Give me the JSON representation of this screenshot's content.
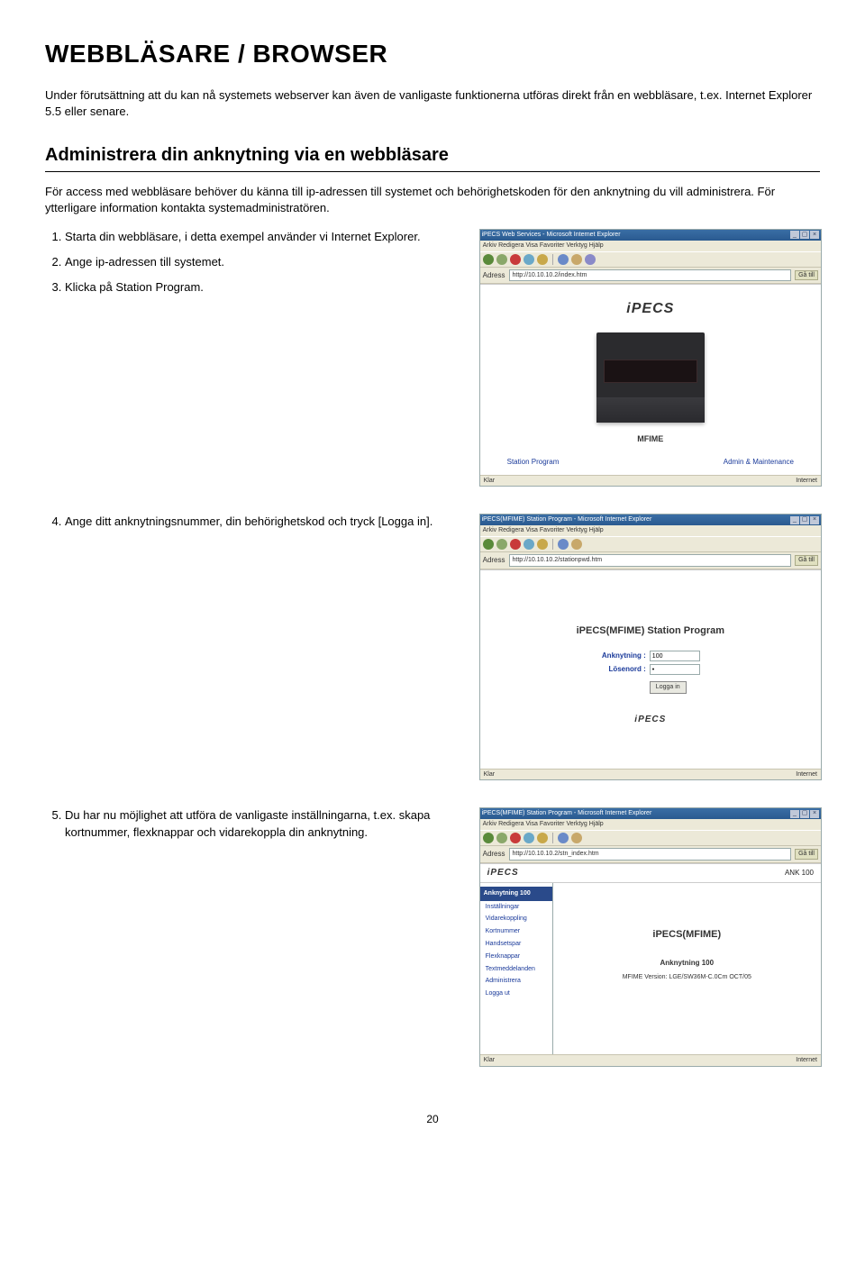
{
  "page": {
    "title": "WEBBLÄSARE / BROWSER",
    "intro": "Under förutsättning att du kan nå systemets webserver kan även de vanligaste funktionerna utföras direkt från en webbläsare, t.ex. Internet Explorer 5.5 eller senare.",
    "section_title": "Administrera din anknytning via en webbläsare",
    "section_intro": "För access med webbläsare behöver du känna till ip-adressen till systemet och behörighetskoden för den anknytning du vill administrera. För ytterligare information kontakta systemadministratören.",
    "page_number": "20"
  },
  "steps": {
    "s1": "Starta din webbläsare, i detta exempel använder vi Internet Explorer.",
    "s2": "Ange ip-adressen till systemet.",
    "s3": "Klicka på Station Program.",
    "s4": "Ange ditt anknytningsnummer, din behörighetskod och tryck [Logga in].",
    "s5": "Du har nu möjlighet att utföra de vanligaste inställningarna, t.ex. skapa kortnummer, flexknappar och vidarekoppla din anknytning."
  },
  "screenshot1": {
    "window_title": "iPECS Web Services - Microsoft Internet Explorer",
    "menubar": "Arkiv   Redigera   Visa   Favoriter   Verktyg   Hjälp",
    "address_label": "Adress",
    "address": "http://10.10.10.2/index.htm",
    "go": "Gå till",
    "logo": "iPECS",
    "model": "MFIME",
    "link_left": "Station Program",
    "link_right": "Admin & Maintenance",
    "status_left": "Klar",
    "status_right": "Internet"
  },
  "screenshot2": {
    "window_title": "iPECS(MFIME) Station Program - Microsoft Internet Explorer",
    "menubar": "Arkiv   Redigera   Visa   Favoriter   Verktyg   Hjälp",
    "address_label": "Adress",
    "address": "http://10.10.10.2/stationpwd.htm",
    "go": "Gå till",
    "title": "iPECS(MFIME) Station Program",
    "label_ext": "Anknytning :",
    "value_ext": "100",
    "label_pwd": "Lösenord :",
    "value_pwd": "•",
    "login": "Logga in",
    "ipecs": "iPECS",
    "status_left": "Klar",
    "status_right": "Internet"
  },
  "screenshot3": {
    "window_title": "iPECS(MFIME) Station Program - Microsoft Internet Explorer",
    "menubar": "Arkiv   Redigera   Visa   Favoriter   Verktyg   Hjälp",
    "address_label": "Adress",
    "address": "http://10.10.10.2/stn_index.htm",
    "go": "Gå till",
    "header_logo": "iPECS",
    "header_station": "ANK 100",
    "side_head": "Anknytning 100",
    "side_items": [
      "Inställningar",
      "Vidarekoppling",
      "Kortnummer",
      "Handsetspar",
      "Flexknappar",
      "Textmeddelanden",
      "Administrera",
      "Logga ut"
    ],
    "main_title": "iPECS(MFIME)",
    "main_sub": "Anknytning 100",
    "main_ver": "MFIME Version: LGE/SW36M-C.0Cm OCT/05",
    "status_left": "Klar",
    "status_right": "Internet"
  }
}
